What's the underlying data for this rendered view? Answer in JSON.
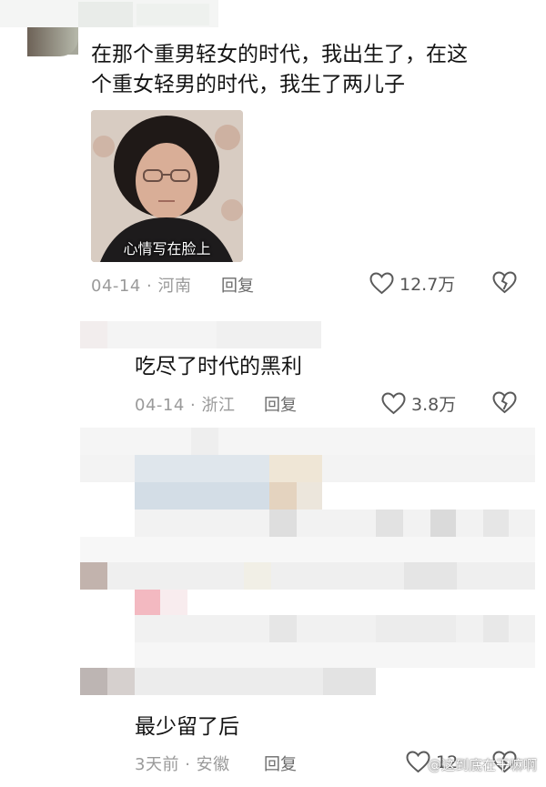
{
  "comments": [
    {
      "text_line1": "在那个重男轻女的时代，我出生了，在这",
      "text_line2": "个重女轻男的时代，我生了两儿子",
      "sticker_caption": "心情写在脸上",
      "date": "04-14",
      "location": "河南",
      "reply_label": "回复",
      "likes": "12.7万",
      "like_icon": "heart-icon",
      "dislike_icon": "broken-heart-icon"
    },
    {
      "text": "吃尽了时代的黑利",
      "date": "04-14",
      "location": "浙江",
      "reply_label": "回复",
      "likes": "3.8万",
      "like_icon": "heart-icon",
      "dislike_icon": "broken-heart-icon"
    },
    {
      "text": "最少留了后",
      "date": "3天前",
      "location": "安徽",
      "reply_label": "回复",
      "likes": "12",
      "like_icon": "heart-icon",
      "dislike_icon": "broken-heart-icon"
    }
  ],
  "separator": "·",
  "watermark": "@这到底在干嘛啊"
}
